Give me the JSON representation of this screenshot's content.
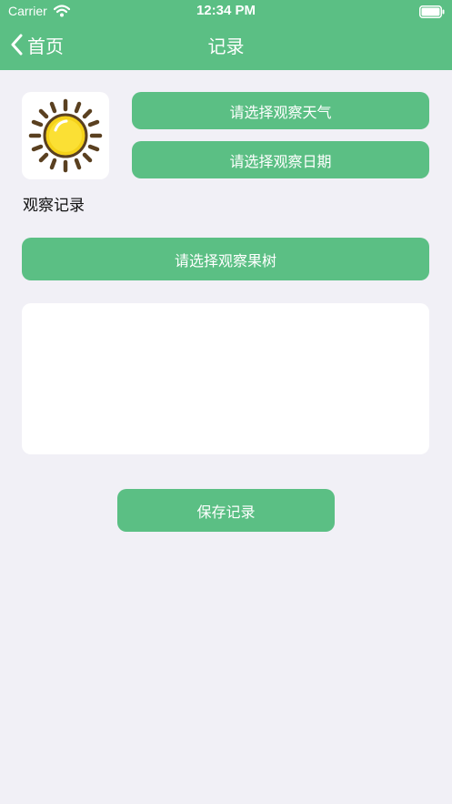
{
  "status_bar": {
    "carrier": "Carrier",
    "time": "12:34 PM"
  },
  "nav": {
    "back_label": "首页",
    "title": "记录"
  },
  "weather_image": {
    "icon": "sun-icon"
  },
  "buttons": {
    "select_weather": "请选择观察天气",
    "select_date": "请选择观察日期",
    "select_tree": "请选择观察果树",
    "save": "保存记录"
  },
  "section_label": "观察记录",
  "notes": {
    "value": ""
  },
  "colors": {
    "accent": "#5bbf84",
    "background": "#f1f0f6",
    "card": "#ffffff",
    "sun_yellow": "#f5d21a",
    "sun_rays": "#5a4020"
  }
}
